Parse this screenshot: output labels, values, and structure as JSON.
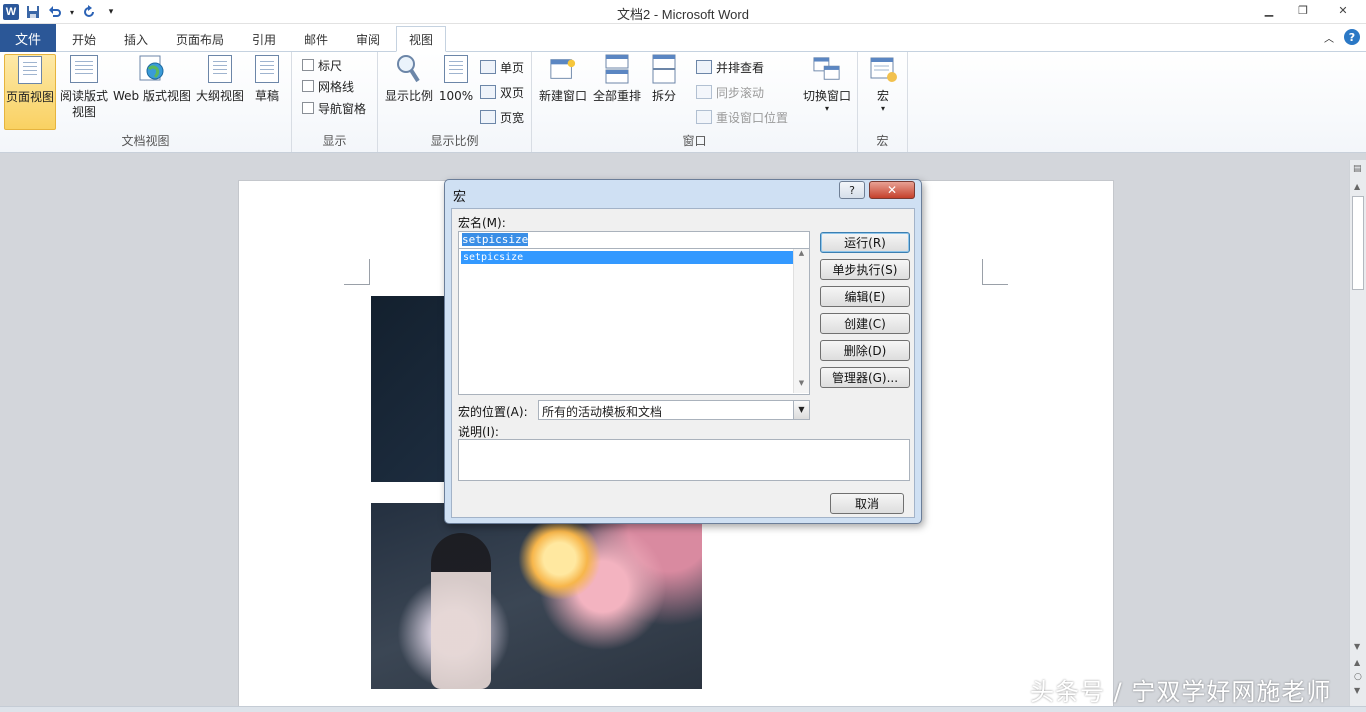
{
  "window": {
    "title": "文档2 - Microsoft Word",
    "app_logo": "W",
    "controls": [
      "minimize-icon",
      "restore-icon",
      "close-icon"
    ]
  },
  "qat": {
    "icons": [
      "save-icon",
      "undo-icon",
      "redo-icon",
      "customize-icon"
    ]
  },
  "tabs": [
    {
      "label": "文件"
    },
    {
      "label": "开始"
    },
    {
      "label": "插入"
    },
    {
      "label": "页面布局"
    },
    {
      "label": "引用"
    },
    {
      "label": "邮件"
    },
    {
      "label": "审阅"
    },
    {
      "label": "视图"
    }
  ],
  "active_tab": "视图",
  "ribbon": {
    "doc_views": {
      "label": "文档视图",
      "print_layout": "页面视图",
      "full_reading_1": "阅读版式",
      "full_reading_2": "视图",
      "web_layout": "Web 版式视图",
      "outline": "大纲视图",
      "draft": "草稿"
    },
    "show": {
      "label": "显示",
      "ruler": "标尺",
      "gridlines": "网格线",
      "nav_pane": "导航窗格"
    },
    "zoom": {
      "label": "显示比例",
      "zoom": "显示比例",
      "hundred": "100%",
      "one_page": "单页",
      "two_pages": "双页",
      "page_width": "页宽"
    },
    "window": {
      "label": "窗口",
      "new_window": "新建窗口",
      "arrange_all": "全部重排",
      "split": "拆分",
      "side_by_side": "并排查看",
      "sync_scroll": "同步滚动",
      "reset_position": "重设窗口位置",
      "switch_windows": "切换窗口"
    },
    "macros": {
      "label": "宏",
      "macros": "宏"
    }
  },
  "dialog": {
    "title": "宏",
    "help": "?",
    "close": "✕",
    "macro_name_label": "宏名(M):",
    "macro_name_value": "setpicsize",
    "macro_list": [
      "setpicsize"
    ],
    "location_label": "宏的位置(A):",
    "location_value": "所有的活动模板和文档",
    "description_label": "说明(I):",
    "description_value": "",
    "buttons": {
      "run": "运行(R)",
      "step": "单步执行(S)",
      "edit": "编辑(E)",
      "create": "创建(C)",
      "delete": "删除(D)",
      "organizer": "管理器(G)...",
      "cancel": "取消"
    }
  },
  "watermark": "头条号 / 宁双学好网施老师"
}
